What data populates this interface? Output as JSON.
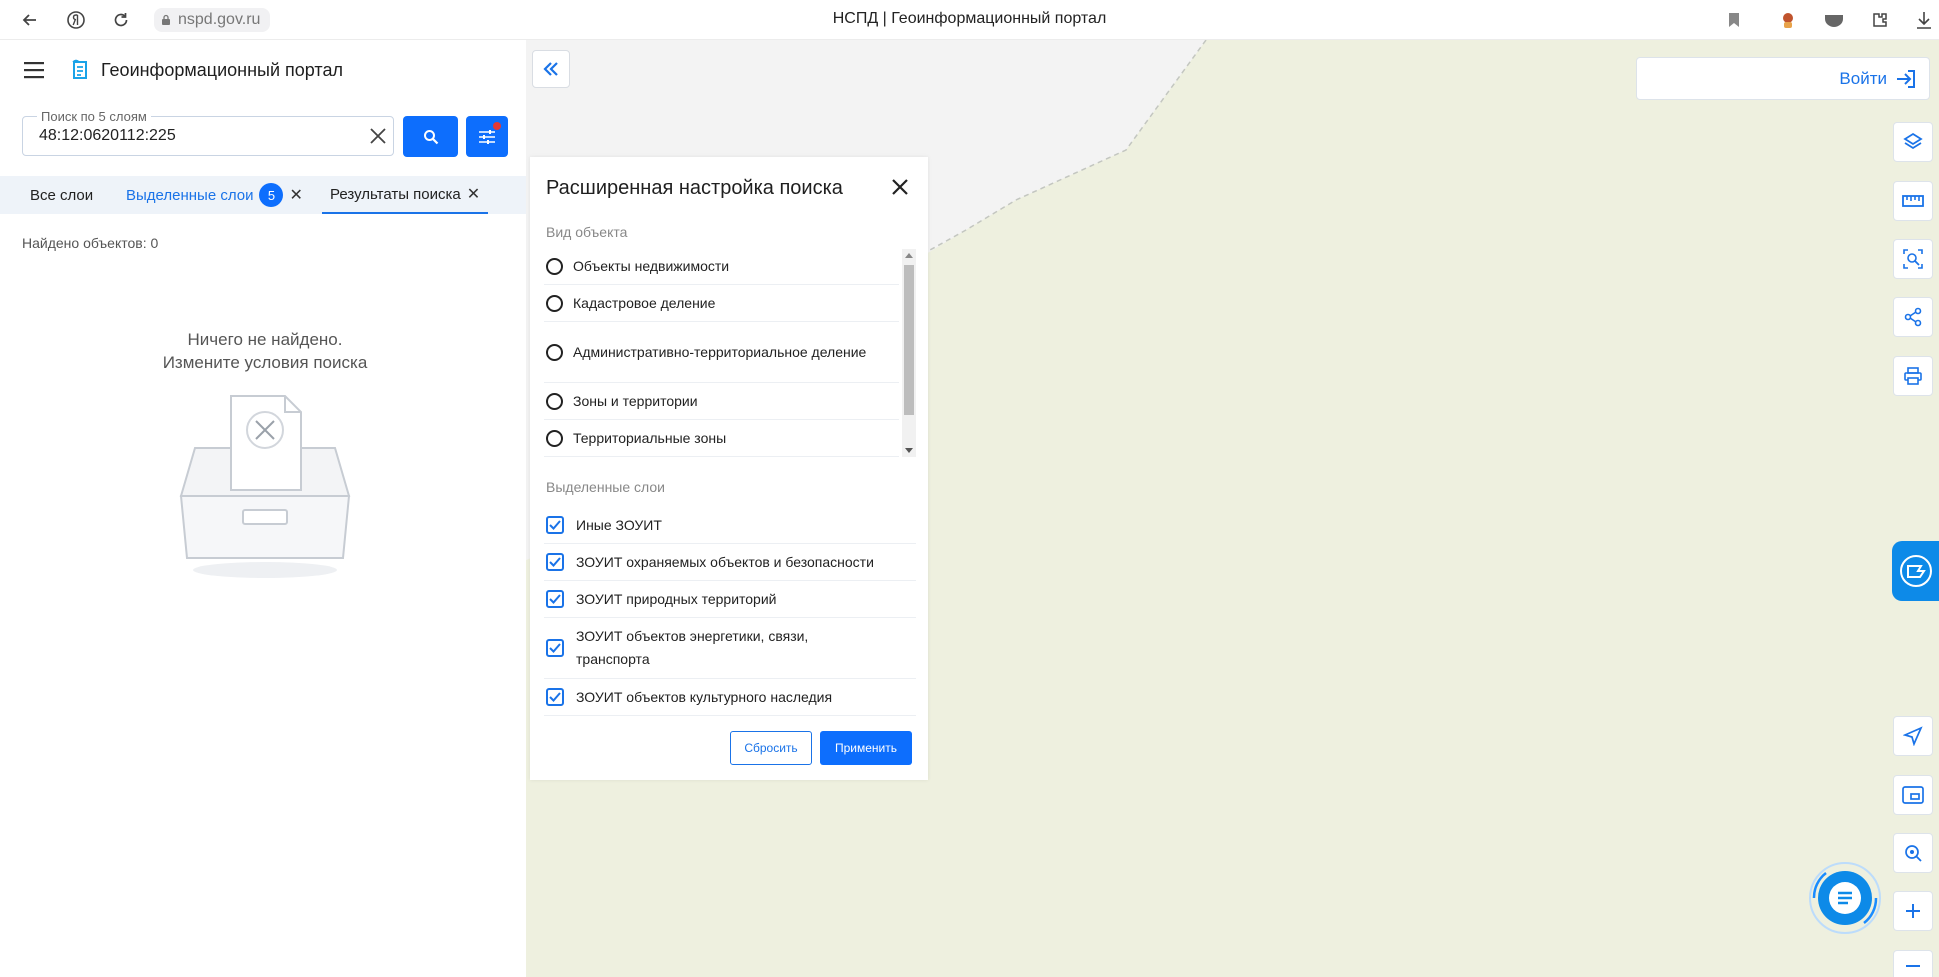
{
  "browser": {
    "url": "nspd.gov.ru",
    "title": "НСПД | Геоинформационный портал"
  },
  "sidebar": {
    "portal_title": "Геоинформационный портал",
    "search": {
      "legend": "Поиск по 5 слоям",
      "value": "48:12:0620112:225"
    },
    "tabs": [
      {
        "label": "Все слои"
      },
      {
        "label": "Выделенные слои",
        "badge": "5"
      },
      {
        "label": "Результаты поиска"
      }
    ],
    "found_count": "Найдено объектов: 0",
    "empty_line1": "Ничего не найдено.",
    "empty_line2": "Измените условия поиска"
  },
  "map": {
    "login_label": "Войти",
    "colors": {
      "map_bg": "#f3f3f3",
      "map_land": "#eef0df",
      "accent": "#0d6efd"
    }
  },
  "panel": {
    "title": "Расширенная настройка поиска",
    "object_type_label": "Вид объекта",
    "object_types": [
      "Объекты недвижимости",
      "Кадастровое деление",
      "Административно-территориальное деление",
      "Зоны и территории",
      "Территориальные зоны"
    ],
    "selected_layers_label": "Выделенные слои",
    "selected_layers": [
      "Иные ЗОУИТ",
      "ЗОУИТ охраняемых объектов и безопасности",
      "ЗОУИТ природных территорий",
      "ЗОУИТ объектов энергетики, связи, транспорта",
      "ЗОУИТ объектов культурного наследия"
    ],
    "reset_label": "Сбросить",
    "apply_label": "Применить"
  }
}
